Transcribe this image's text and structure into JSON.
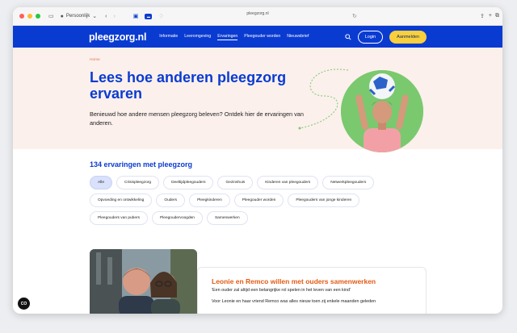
{
  "browser": {
    "profile_label": "Persoonlijk",
    "url": "pleegzorg.nl"
  },
  "nav": {
    "logo": "pleegzorg.nl",
    "links": [
      "Informatie",
      "Leeromgeving",
      "Ervaringen",
      "Pleegouder worden",
      "Nieuwsbrief"
    ],
    "active_link": "Ervaringen",
    "login_label": "Login",
    "signup_label": "Aanmelden"
  },
  "hero": {
    "breadcrumb": "Home",
    "title": "Lees hoe anderen pleegzorg ervaren",
    "intro": "Benieuwd hoe andere mensen pleegzorg beleven? Ontdek hier de ervaringen van anderen."
  },
  "filters": {
    "heading": "134 ervaringen met pleegzorg",
    "chips": [
      "Alle",
      "Crisispleegzorg",
      "Deeltijdpleegouders",
      "Gezinshuis",
      "Kinderen van pleegouders",
      "Netwerkpleegouders",
      "Opvoeding en ontwikkeling",
      "Ouders",
      "Pleegkinderen",
      "Pleegouder worden",
      "Pleegouders van jonge kinderen",
      "Pleegouders van pubers",
      "Pleegoudervoogden",
      "Samenwerken"
    ],
    "selected": "Alle"
  },
  "story": {
    "title": "Leonie en Remco willen met ouders samenwerken",
    "quote": "'Een ouder zal altijd een belangrijke rol spelen in het leven van een kind'",
    "excerpt": "Voor Leonie en haar vriend Remco was alles nieuw toen zij enkele maanden geleden"
  },
  "cookie_badge": "CO",
  "colors": {
    "brand_blue": "#0a3bd1",
    "cta_yellow": "#f9cf3c",
    "hero_bg": "#fbf0ec",
    "accent_orange": "#e35a14"
  }
}
